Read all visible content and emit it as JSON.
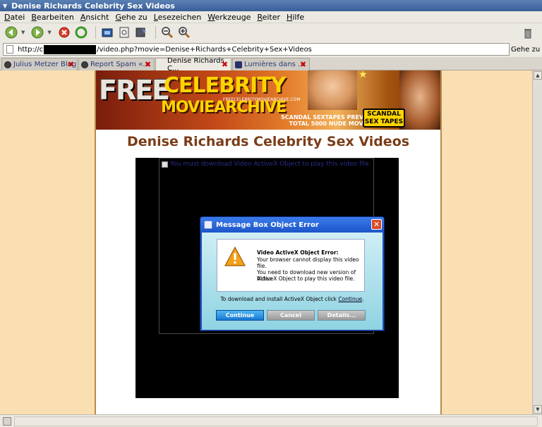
{
  "window": {
    "title": "Denise Richards Celebrity Sex Videos"
  },
  "menu": [
    "Datei",
    "Bearbeiten",
    "Ansicht",
    "Gehe zu",
    "Lesezeichen",
    "Werkzeuge",
    "Reiter",
    "Hilfe"
  ],
  "toolbar": {
    "icons": [
      "back-icon",
      "forward-icon",
      "stop-icon",
      "reload-icon",
      "home-icon",
      "print-icon",
      "bookmark-icon",
      "zoom-out-icon",
      "zoom-in-icon",
      "trash-icon"
    ]
  },
  "address": {
    "prefix": "http://c",
    "suffix": "/video.php?movie=Denise+Richards+Celebrity+Sex+Videos",
    "go_label": "Gehe zu"
  },
  "tabs": [
    {
      "label": "Julius Metzer Blog"
    },
    {
      "label": "Report Spam «..."
    },
    {
      "label": "Denise Richards C..."
    },
    {
      "label": "Lumières dans ..."
    }
  ],
  "banner": {
    "free": "FREE",
    "celebrity": "CELEBRITY",
    "movie_archive": "MOVIEARCHIVE",
    "site": "FREECELEBRITYMOVIEARCHIVE.COM",
    "tagline_1": "SCANDAL SEXTAPES PREVIEW",
    "tagline_2": "TOTAL 5000 NUDE MOVIES!",
    "button_1": "SCANDAL",
    "button_2": "SEX TAPES"
  },
  "page": {
    "heading": "Denise Richards Celebrity Sex Videos",
    "plugin_notice": "You must download Video ActiveX Object to play this video file."
  },
  "dialog": {
    "title": "Message Box Object Error",
    "error_title": "Video ActiveX Object Error:",
    "error_line_1": "Your browser cannot display this video file.",
    "error_line_2": "You need to download new version of Video",
    "error_line_3": "ActiveX Object to play this video file.",
    "download_text": "To download and install ActiveX Object click",
    "download_link": "Continue",
    "buttons": {
      "continue": "Continue",
      "cancel": "Cancel",
      "details": "Details..."
    }
  },
  "colors": {
    "page_background": "#f9dfb2",
    "heading": "#7a3d18",
    "titlebar": "#3a5f98"
  }
}
